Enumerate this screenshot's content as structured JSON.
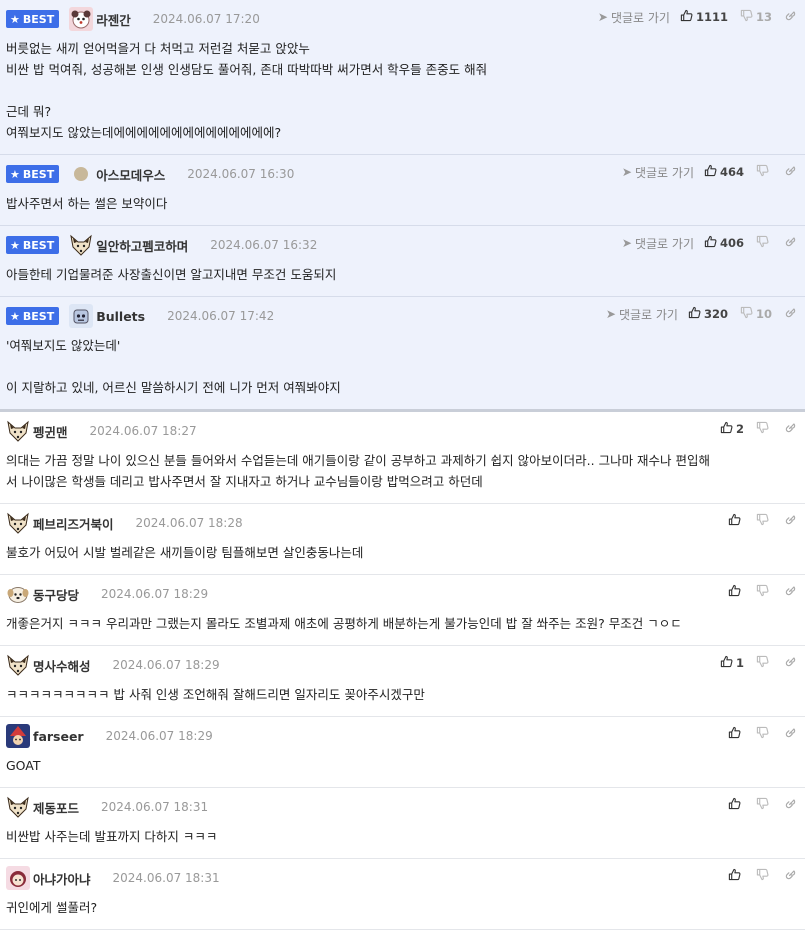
{
  "best_label": "BEST",
  "goto_label": "댓글로 가기",
  "comments": [
    {
      "nick": "라젠간",
      "time": "2024.06.07 17:20",
      "up": "1111",
      "down": "13",
      "avatar": "dog-icon",
      "goto": true,
      "lines": [
        "버릇없는 새끼 얻어먹을거 다 처먹고 저런걸 처묻고 앉았누",
        "비싼 밥 먹여줘, 성공해본 인생 인생담도 풀어줘, 존대 따박따박 써가면서 학우들 존중도 해줘",
        "",
        "근데 뭐?",
        "여쭤보지도 않았는데에에에에에에에에에에에에에에?"
      ]
    },
    {
      "nick": "아스모데우스",
      "time": "2024.06.07 16:30",
      "up": "464",
      "down": "",
      "avatar": "circle-avatar-icon",
      "goto": true,
      "lines": [
        "밥사주면서 하는 썰은 보약이다"
      ]
    },
    {
      "nick": "일안하고펨코하며",
      "time": "2024.06.07 16:32",
      "up": "406",
      "down": "",
      "avatar": "fox-icon",
      "goto": true,
      "lines": [
        "아들한테 기업물려준 사장출신이면 알고지내면 무조건 도움되지"
      ]
    },
    {
      "nick": "Bullets",
      "time": "2024.06.07 17:42",
      "up": "320",
      "down": "10",
      "avatar": "robot-icon",
      "goto": true,
      "lines": [
        "'여쭤보지도 않았는데'",
        "",
        "이 지랄하고 있네, 어르신 말씀하시기 전에 니가 먼저 여쭤봐야지"
      ]
    },
    {
      "nick": "펭귄맨",
      "time": "2024.06.07 18:27",
      "up": "2",
      "down": "",
      "avatar": "fox-icon",
      "goto": false,
      "lines": [
        "의대는 가끔 정말 나이 있으신 분들 들어와서 수업듣는데 애기들이랑 같이 공부하고 과제하기 쉽지 않아보이더라.. 그나마 재수나 편입해",
        "서 나이많은 학생들 데리고 밥사주면서 잘 지내자고 하거나 교수님들이랑 밥먹으려고 하던데"
      ]
    },
    {
      "nick": "페브리즈거북이",
      "time": "2024.06.07 18:28",
      "up": "",
      "down": "",
      "avatar": "fox-icon",
      "goto": false,
      "lines": [
        "불호가 어딨어 시발 벌레같은 새끼들이랑 팀플해보면 살인충동나는데"
      ]
    },
    {
      "nick": "동구당당",
      "time": "2024.06.07 18:29",
      "up": "",
      "down": "",
      "avatar": "dog-face-icon",
      "goto": false,
      "lines": [
        "개좋은거지 ㅋㅋㅋ 우리과만 그랬는지 몰라도 조별과제 애초에 공평하게 배분하는게 불가능인데 밥 잘 쏴주는 조원? 무조건 ㄱㅇㄷ"
      ]
    },
    {
      "nick": "명사수해성",
      "time": "2024.06.07 18:29",
      "up": "1",
      "down": "",
      "avatar": "fox-icon",
      "goto": false,
      "lines": [
        "ㅋㅋㅋㅋㅋㅋㅋㅋㅋ 밥 사줘 인생 조언해줘 잘해드리면 일자리도 꽂아주시겠구만"
      ]
    },
    {
      "nick": "farseer",
      "time": "2024.06.07 18:29",
      "up": "",
      "down": "",
      "avatar": "wizard-icon",
      "goto": false,
      "lines": [
        "GOAT"
      ]
    },
    {
      "nick": "제동포드",
      "time": "2024.06.07 18:31",
      "up": "",
      "down": "",
      "avatar": "fox-icon",
      "goto": false,
      "lines": [
        "비싼밥 사주는데 발표까지 다하지 ㅋㅋㅋ"
      ]
    },
    {
      "nick": "아냐가아냐",
      "time": "2024.06.07 18:31",
      "up": "",
      "down": "",
      "avatar": "anime-girl-icon",
      "goto": false,
      "lines": [
        "귀인에게 썰풀러?"
      ]
    }
  ]
}
